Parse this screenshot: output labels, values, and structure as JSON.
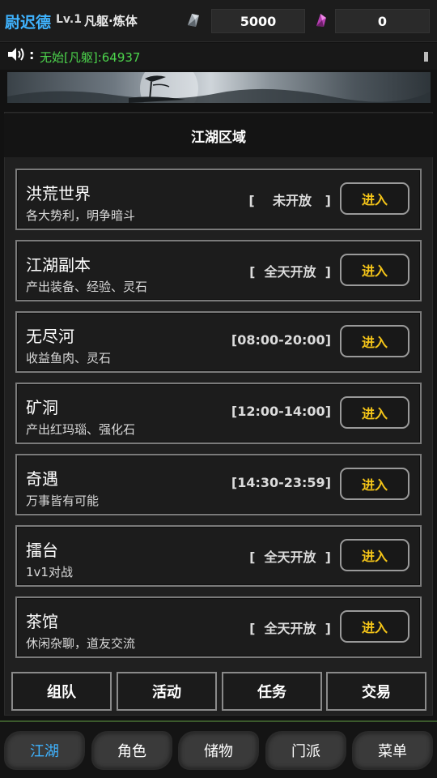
{
  "player": {
    "name": "尉迟德",
    "level": "Lv.1",
    "realm": "凡躯·炼体"
  },
  "resources": {
    "silver_icon": "silver-ore-icon",
    "silver_value": "5000",
    "crystal_icon": "purple-crystal-icon",
    "crystal_value": "0"
  },
  "announcement": {
    "icon": "speaker-icon",
    "colon": ":",
    "text": "无始[凡躯]:64937"
  },
  "panel": {
    "title": "江湖区域"
  },
  "regions": [
    {
      "title": "洪荒世界",
      "desc": "各大势利，明争暗斗",
      "status": "[    未开放   ]",
      "button": "进入"
    },
    {
      "title": "江湖副本",
      "desc": "产出装备、经验、灵石",
      "status": "[  全天开放  ]",
      "button": "进入"
    },
    {
      "title": "无尽河",
      "desc": "收益鱼肉、灵石",
      "status": "[08:00-20:00]",
      "button": "进入"
    },
    {
      "title": "矿洞",
      "desc": "产出红玛瑙、强化石",
      "status": "[12:00-14:00]",
      "button": "进入"
    },
    {
      "title": "奇遇",
      "desc": "万事皆有可能",
      "status": "[14:30-23:59]",
      "button": "进入"
    },
    {
      "title": "擂台",
      "desc": "1v1对战",
      "status": "[  全天开放  ]",
      "button": "进入"
    },
    {
      "title": "茶馆",
      "desc": "休闲杂聊，道友交流",
      "status": "[  全天开放  ]",
      "button": "进入"
    }
  ],
  "actions": [
    "组队",
    "活动",
    "任务",
    "交易"
  ],
  "nav": {
    "tabs": [
      "江湖",
      "角色",
      "储物",
      "门派",
      "菜单"
    ],
    "active": "江湖"
  },
  "colors": {
    "name": "#3fb3ff",
    "announcement": "#4cd44c",
    "enter_button_text": "#f5c518",
    "active_tab": "#3fb3ff"
  }
}
